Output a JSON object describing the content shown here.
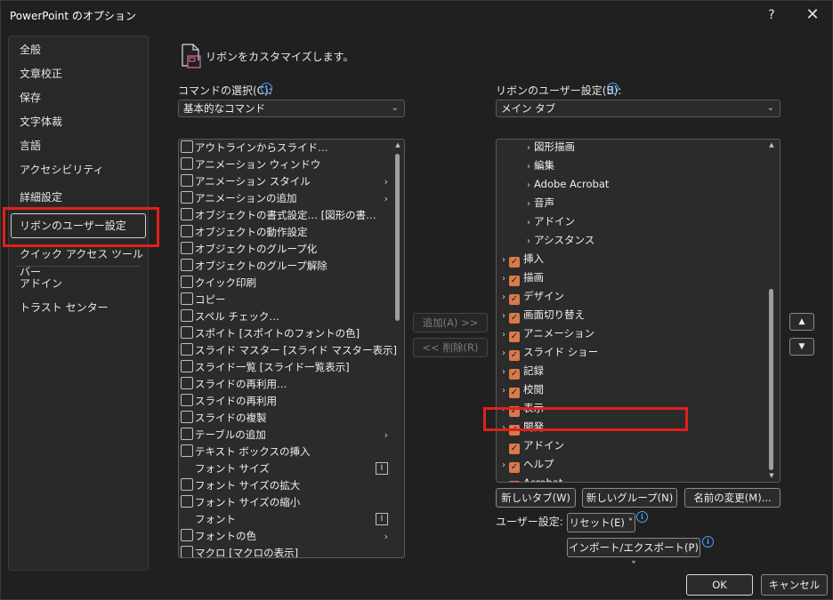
{
  "window": {
    "title": "PowerPoint のオプション",
    "help_label": "?",
    "close_label": "✕"
  },
  "nav": {
    "items": [
      {
        "label": "全般"
      },
      {
        "label": "文章校正"
      },
      {
        "label": "保存"
      },
      {
        "label": "文字体裁"
      },
      {
        "label": "言語"
      },
      {
        "label": "アクセシビリティ"
      },
      {
        "label": "詳細設定"
      },
      {
        "label": "リボンのユーザー設定",
        "selected": true
      },
      {
        "label": "クイック アクセス ツール バー"
      },
      {
        "label": "アドイン"
      },
      {
        "label": "トラスト センター"
      }
    ]
  },
  "header": {
    "text": "リボンをカスタマイズします。",
    "icon": "customize-ribbon-icon"
  },
  "commands": {
    "label": "コマンドの選択(C):",
    "selected": "基本的なコマンド",
    "items": [
      {
        "label": "アウトラインからスライド…",
        "icon": "outline-icon"
      },
      {
        "label": "アニメーション ウィンドウ",
        "icon": "animation-pane-icon"
      },
      {
        "label": "アニメーション スタイル",
        "icon": "animation-style-icon",
        "arrow": "›"
      },
      {
        "label": "アニメーションの追加",
        "icon": "add-animation-icon",
        "arrow": "›"
      },
      {
        "label": "オブジェクトの書式設定… [図形の書…",
        "icon": "format-object-icon"
      },
      {
        "label": "オブジェクトの動作設定",
        "icon": "action-icon"
      },
      {
        "label": "オブジェクトのグループ化",
        "icon": "group-icon"
      },
      {
        "label": "オブジェクトのグループ解除",
        "icon": "ungroup-icon"
      },
      {
        "label": "クイック印刷",
        "icon": "quick-print-icon"
      },
      {
        "label": "コピー",
        "icon": "copy-icon"
      },
      {
        "label": "スペル チェック…",
        "icon": "spellcheck-icon"
      },
      {
        "label": "スポイト [スポイトのフォントの色]",
        "icon": "eyedropper-icon"
      },
      {
        "label": "スライド マスター [スライド マスター表示]",
        "icon": "slide-master-icon"
      },
      {
        "label": "スライド一覧 [スライド一覧表示]",
        "icon": "slide-sorter-icon"
      },
      {
        "label": "スライドの再利用…",
        "icon": "reuse-slides-icon"
      },
      {
        "label": "スライドの再利用",
        "icon": "reuse-slides-icon"
      },
      {
        "label": "スライドの複製",
        "icon": "duplicate-slide-icon"
      },
      {
        "label": "テーブルの追加",
        "icon": "table-icon",
        "arrow": "›"
      },
      {
        "label": "テキスト ボックスの挿入",
        "icon": "textbox-icon"
      },
      {
        "label": "フォント サイズ",
        "icon": "none",
        "drop": "I"
      },
      {
        "label": "フォント サイズの拡大",
        "icon": "font-grow-icon"
      },
      {
        "label": "フォント サイズの縮小",
        "icon": "font-shrink-icon"
      },
      {
        "label": "フォント",
        "icon": "none",
        "drop": "I"
      },
      {
        "label": "フォントの色",
        "icon": "font-color-icon",
        "arrow": "›"
      },
      {
        "label": "マクロ [マクロの表示]",
        "icon": "macro-icon"
      }
    ]
  },
  "ribbon": {
    "label": "リボンのユーザー設定(B):",
    "selected": "メイン タブ",
    "items": [
      {
        "label": "図形描画",
        "indent": 2,
        "checked": false
      },
      {
        "label": "編集",
        "indent": 2,
        "checked": false
      },
      {
        "label": "Adobe Acrobat",
        "indent": 2,
        "checked": false
      },
      {
        "label": "音声",
        "indent": 2,
        "checked": false
      },
      {
        "label": "アドイン",
        "indent": 2,
        "checked": false
      },
      {
        "label": "アシスタンス",
        "indent": 2,
        "checked": false
      },
      {
        "label": "挿入",
        "indent": 0,
        "checked": true
      },
      {
        "label": "描画",
        "indent": 0,
        "checked": true
      },
      {
        "label": "デザイン",
        "indent": 0,
        "checked": true
      },
      {
        "label": "画面切り替え",
        "indent": 0,
        "checked": true
      },
      {
        "label": "アニメーション",
        "indent": 0,
        "checked": true
      },
      {
        "label": "スライド ショー",
        "indent": 0,
        "checked": true
      },
      {
        "label": "記録",
        "indent": 0,
        "checked": true
      },
      {
        "label": "校閲",
        "indent": 0,
        "checked": true
      },
      {
        "label": "表示",
        "indent": 0,
        "checked": true
      },
      {
        "label": "開発",
        "indent": 0,
        "checked": true
      },
      {
        "label": "アドイン",
        "indent": 0,
        "checked": true,
        "no_expander": true
      },
      {
        "label": "ヘルプ",
        "indent": 0,
        "checked": true
      },
      {
        "label": "Acrobat",
        "indent": 0,
        "checked": true
      }
    ]
  },
  "buttons": {
    "add": "追加(A) >>",
    "remove": "<< 削除(R)",
    "new_tab": "新しいタブ(W)",
    "new_group": "新しいグループ(N)",
    "rename": "名前の変更(M)...",
    "custom_label": "ユーザー設定:",
    "reset": "リセット(E) ˅",
    "import_export": "インポート/エクスポート(P) ˅",
    "ok": "OK",
    "cancel": "キャンセル",
    "move_up": "▲",
    "move_down": "▼"
  },
  "colors": {
    "checkbox": "#d97a4a",
    "highlight": "#e0201d",
    "info": "#4ea1ff"
  }
}
